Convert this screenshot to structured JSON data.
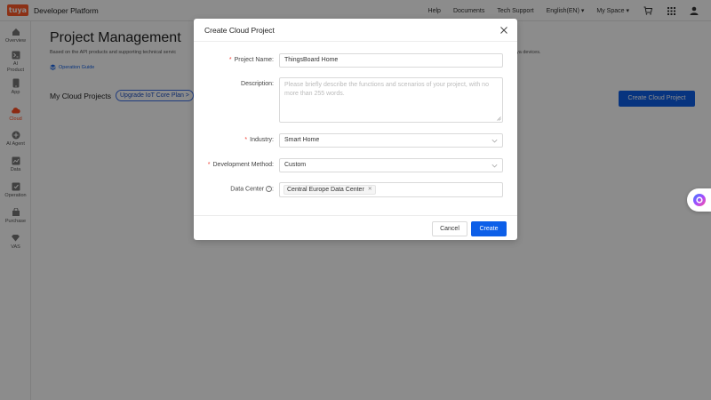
{
  "header": {
    "logo_text": "tuya",
    "brand": "Developer Platform",
    "nav": [
      "Help",
      "Documents",
      "Tech Support",
      "English(EN) ▾",
      "My Space ▾"
    ]
  },
  "sidebar": {
    "items": [
      {
        "label": "Overview",
        "icon": "home-icon"
      },
      {
        "label": "AI Product",
        "icon": "ai-product-icon"
      },
      {
        "label": "App",
        "icon": "app-icon"
      },
      {
        "label": "Cloud",
        "icon": "cloud-icon",
        "active": true
      },
      {
        "label": "AI Agent",
        "icon": "ai-agent-icon"
      },
      {
        "label": "Data",
        "icon": "data-icon"
      },
      {
        "label": "Operation",
        "icon": "operation-icon"
      },
      {
        "label": "Purchase",
        "icon": "purchase-icon"
      },
      {
        "label": "VAS",
        "icon": "vas-icon"
      }
    ]
  },
  "main": {
    "title": "Project Management",
    "description": "Based on the API products and supporting technical servic",
    "description_tail": "ya devices.",
    "operation_guide": "Operation Guide",
    "my_projects": "My Cloud Projects",
    "upgrade_link": "Upgrade IoT Core Plan >",
    "create_button": "Create Cloud Project"
  },
  "modal": {
    "title": "Create Cloud Project",
    "fields": {
      "project_name": {
        "label": "Project Name",
        "value": "ThingsBoard Home",
        "required": true
      },
      "description": {
        "label": "Description",
        "placeholder": "Please briefly describe the functions and scenarios of your project, with no more than 255 words.",
        "required": false
      },
      "industry": {
        "label": "Industry",
        "value": "Smart Home",
        "required": true
      },
      "development_method": {
        "label": "Development Method",
        "value": "Custom",
        "required": true
      },
      "data_center": {
        "label": "Data Center",
        "value": "Central Europe Data Center",
        "required": false
      }
    },
    "cancel_label": "Cancel",
    "create_label": "Create"
  },
  "colors": {
    "primary": "#0d5fe8",
    "brand_orange": "#ff5a28",
    "required_star": "#f04134",
    "active_nav": "#ff4d21"
  }
}
